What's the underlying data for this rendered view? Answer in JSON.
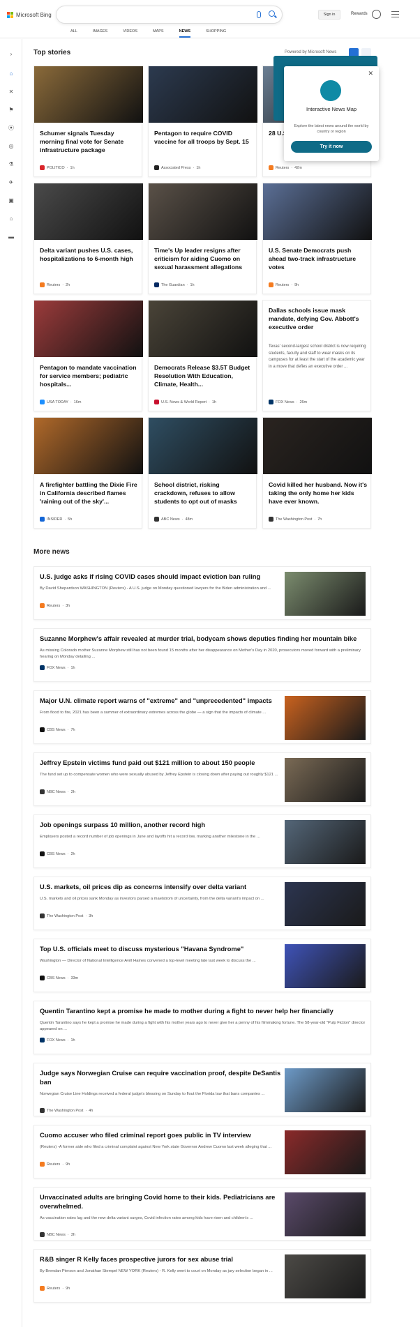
{
  "header": {
    "logo_text": "Microsoft Bing",
    "sign_in": "Sign in",
    "rewards": "Rewards",
    "nav": [
      "ALL",
      "IMAGES",
      "VIDEOS",
      "MAPS",
      "NEWS",
      "SHOPPING"
    ],
    "active_nav": "NEWS"
  },
  "rail_icons": [
    "expand-icon",
    "home-icon",
    "sports-icon",
    "politics-icon",
    "location-icon",
    "world-icon",
    "science-icon",
    "technology-icon",
    "entertainment-icon",
    "business-icon",
    "money-icon"
  ],
  "top_stories": {
    "title": "Top stories",
    "powered_by": "Powered by Microsoft News",
    "cards": [
      {
        "title": "Schumer signals Tuesday morning final vote for Senate infrastructure package",
        "source": "POLITICO",
        "time": "1h",
        "color": "#8a6a3a",
        "src_color": "#d9252a"
      },
      {
        "title": "Pentagon to require COVID vaccine for all troops by Sept. 15",
        "source": "Associated Press",
        "time": "1h",
        "color": "#2c3a4f",
        "src_color": "#222"
      },
      {
        "title": "28 U.S. ... $85 B... infra...",
        "source": "Reuters",
        "time": "42m",
        "color": "#6a7e93",
        "src_color": "#f47b20"
      },
      {
        "title": "Delta variant pushes U.S. cases, hospitalizations to 6-month high",
        "source": "Reuters",
        "time": "2h",
        "color": "#4a4a4a",
        "src_color": "#f47b20"
      },
      {
        "title": "Time's Up leader resigns after criticism for aiding Cuomo on sexual harassment allegations",
        "source": "The Guardian",
        "time": "1h",
        "color": "#5a5148",
        "src_color": "#052962"
      },
      {
        "title": "U.S. Senate Democrats push ahead two-track infrastructure votes",
        "source": "Reuters",
        "time": "9h",
        "color": "#5b6f96",
        "src_color": "#f47b20"
      },
      {
        "title": "Pentagon to mandate vaccination for service members; pediatric hospitals...",
        "source": "USA TODAY",
        "time": "16m",
        "color": "#9b3b3b",
        "src_color": "#1e90ff"
      },
      {
        "title": "Democrats Release $3.5T Budget Resolution With Education, Climate, Health...",
        "source": "U.S. News & World Report",
        "time": "1h",
        "color": "#4a4438",
        "src_color": "#c8102e"
      },
      {
        "title": "Dallas schools issue mask mandate, defying Gov. Abbott's executive order",
        "desc": "Texas' second-largest school district is now requiring students, faculty and staff to wear masks on its campuses for at least the start of the academic year in a move that defies an executive order ...",
        "source": "FOX News",
        "time": "26m",
        "src_color": "#003366"
      },
      {
        "title": "A firefighter battling the Dixie Fire in California described flames 'raining out of the sky'...",
        "source": "INSIDER",
        "time": "5h",
        "color": "#b0692a",
        "src_color": "#1466d6"
      },
      {
        "title": "School district, risking crackdown, refuses to allow students to opt out of masks",
        "source": "ABC News",
        "time": "48m",
        "color": "#2f4e62",
        "src_color": "#333"
      },
      {
        "title": "Covid killed her husband. Now it's taking the only home her kids have ever known.",
        "source": "The Washington Post",
        "time": "7h",
        "color": "#2a2420",
        "src_color": "#333"
      }
    ]
  },
  "popup": {
    "title": "Interactive News Map",
    "desc": "Explore the latest news around the world by country or region",
    "button": "Try it now"
  },
  "more_news": {
    "title": "More news",
    "items": [
      {
        "title": "U.S. judge asks if rising COVID cases should impact eviction ban ruling",
        "desc": "By David Shepardson WASHINGTON (Reuters) - A U.S. judge on Monday questioned lawyers for the Biden administration and ...",
        "source": "Reuters",
        "time": "3h",
        "thumb": "#7b8c6e",
        "src_color": "#f47b20"
      },
      {
        "title": "Suzanne Morphew's affair revealed at murder trial, bodycam shows deputies finding her mountain bike",
        "desc": "As missing Colorado mother Suzanne Morphew still has not been found 15 months after her disappearance on Mother's Day in 2020, prosecutors moved forward with a preliminary hearing on Monday detailing ...",
        "source": "FOX News",
        "time": "1h",
        "src_color": "#003366"
      },
      {
        "title": "Major U.N. climate report warns of \"extreme\" and \"unprecedented\" impacts",
        "desc": "From flood to fire, 2021 has been a summer of extraordinary extremes across the globe — a sign that the impacts of climate ...",
        "source": "CBS News",
        "time": "7h",
        "thumb": "#c9621f",
        "src_color": "#111"
      },
      {
        "title": "Jeffrey Epstein victims fund paid out $121 million to about 150 people",
        "desc": "The fund set up to compensate women who were sexually abused by Jeffrey Epstein is closing down after paying out roughly $121 ...",
        "source": "NBC News",
        "time": "2h",
        "thumb": "#7a6a55",
        "src_color": "#333"
      },
      {
        "title": "Job openings surpass 10 million, another record high",
        "desc": "Employers posted a record number of job openings in June and layoffs hit a record low, marking another milestone in the ...",
        "source": "CBS News",
        "time": "2h",
        "thumb": "#546678",
        "src_color": "#111"
      },
      {
        "title": "U.S. markets, oil prices dip as concerns intensify over delta variant",
        "desc": "U.S. markets and oil prices sank Monday as investors parsed a maelstrom of uncertainty, from the delta variant's impact on ...",
        "source": "The Washington Post",
        "time": "3h",
        "thumb": "#2c3550",
        "src_color": "#333"
      },
      {
        "title": "Top U.S. officials meet to discuss mysterious \"Havana Syndrome\"",
        "desc": "Washington — Director of National Intelligence Avril Haines convened a top-level meeting late last week to discuss the ...",
        "source": "CBS News",
        "time": "33m",
        "thumb": "#3f53b8",
        "src_color": "#111"
      },
      {
        "title": "Quentin Tarantino kept a promise he made to mother during a fight to never help her financially",
        "desc": "Quentin Tarantino says he kept a promise he made during a fight with his mother years ago to never give her a penny of his filmmaking fortune. The 58-year-old \"Pulp Fiction\" director appeared on ...",
        "source": "FOX News",
        "time": "1h",
        "src_color": "#003366"
      },
      {
        "title": "Judge says Norwegian Cruise can require vaccination proof, despite DeSantis ban",
        "desc": "Norwegian Cruise Line Holdings received a federal judge's blessing on Sunday to flout the Florida law that bans companies ...",
        "source": "The Washington Post",
        "time": "4h",
        "thumb": "#6d9ac7",
        "src_color": "#333"
      },
      {
        "title": "Cuomo accuser who filed criminal report goes public in TV interview",
        "desc": "(Reuters) -A former aide who filed a criminal complaint against New York state Governor Andrew Cuomo last week alleging that ...",
        "source": "Reuters",
        "time": "9h",
        "thumb": "#8a2a2a",
        "src_color": "#f47b20"
      },
      {
        "title": "Unvaccinated adults are bringing Covid home to their kids. Pediatricians are overwhelmed.",
        "desc": "As vaccination rates lag and the new delta variant surges, Covid infection rates among kids have risen and children's ...",
        "source": "NBC News",
        "time": "3h",
        "thumb": "#5a4a6a",
        "src_color": "#333"
      },
      {
        "title": "R&B singer R Kelly faces prospective jurors for sex abuse trial",
        "desc": "By Brendan Pierson and Jonathan Stempel NEW YORK (Reuters) - R. Kelly went to court on Monday as jury selection began in ...",
        "source": "Reuters",
        "time": "9h",
        "thumb": "#4c4a46",
        "src_color": "#f47b20"
      }
    ]
  },
  "colors": {
    "accent": "#2470d5",
    "popup": "#0f6b87"
  }
}
